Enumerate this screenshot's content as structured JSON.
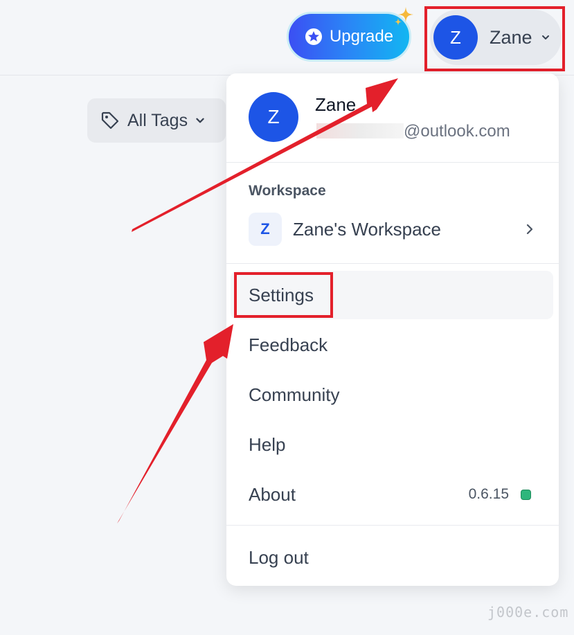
{
  "header": {
    "upgrade_label": "Upgrade",
    "user_initial": "Z",
    "user_name": "Zane",
    "upgrade_icon": "rocket-icon",
    "sparkle_icon": "sparkle-icon"
  },
  "filters": {
    "tags_label": "All Tags",
    "tags_icon": "tag-icon"
  },
  "menu": {
    "profile": {
      "initial": "Z",
      "name": "Zane",
      "email_suffix": "@outlook.com"
    },
    "workspace": {
      "section_label": "Workspace",
      "initial": "Z",
      "name": "Zane's Workspace"
    },
    "items": [
      {
        "label": "Settings"
      },
      {
        "label": "Feedback"
      },
      {
        "label": "Community"
      },
      {
        "label": "Help"
      },
      {
        "label": "About",
        "version": "0.6.15"
      }
    ],
    "logout_label": "Log out"
  },
  "annotations": {
    "highlight_color": "#e3202b",
    "arrow_color": "#e3202b"
  },
  "colors": {
    "accent": "#1d55e6",
    "status_green": "#2fb67c"
  },
  "watermark": "j000e.com"
}
